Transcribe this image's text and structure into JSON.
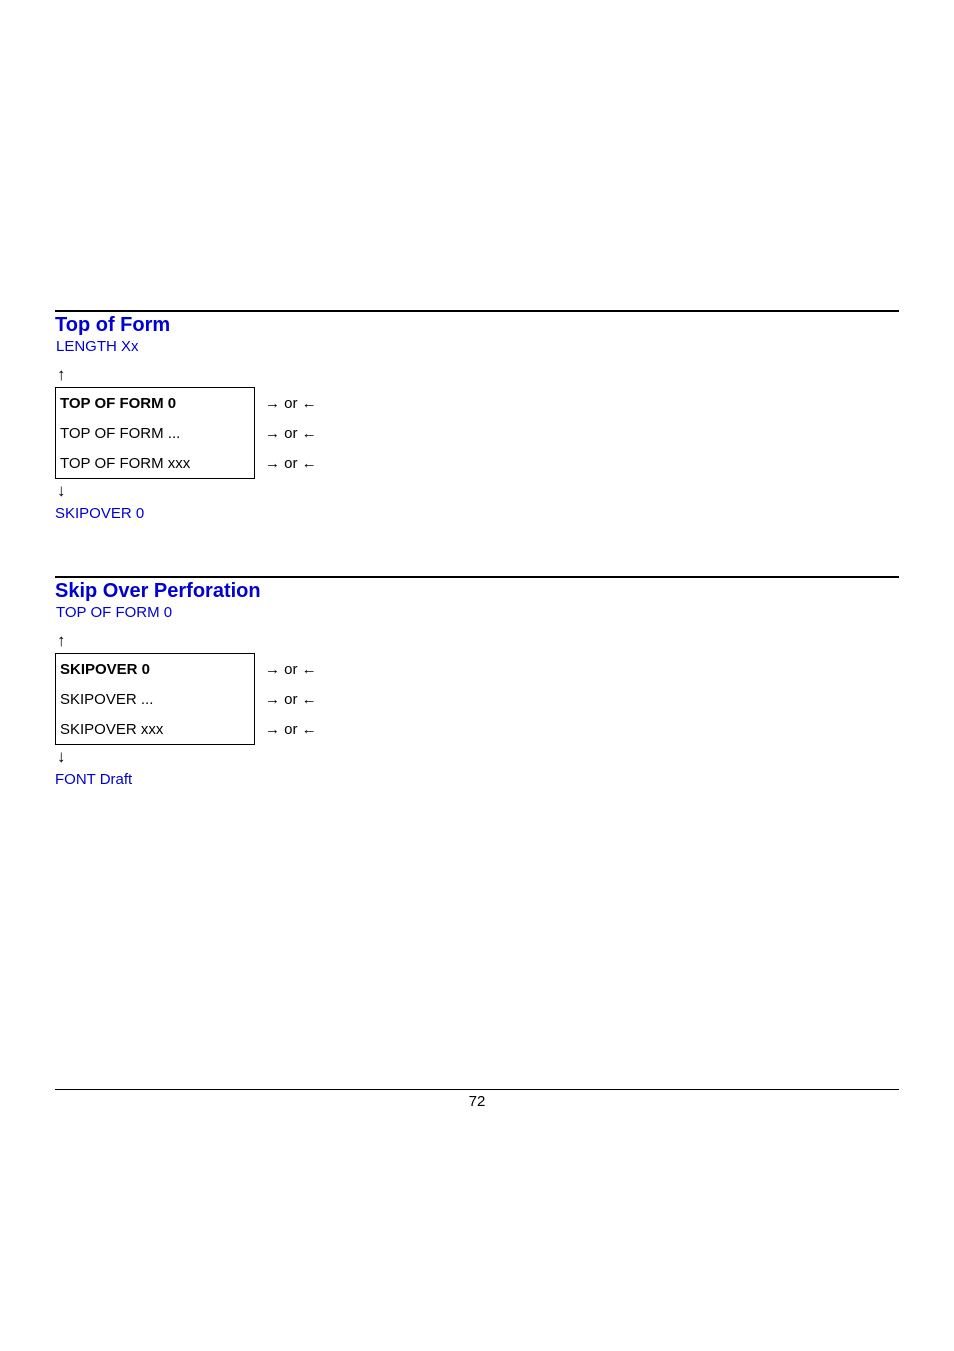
{
  "sections": [
    {
      "title": "Top of Form",
      "subhead": "LENGTH Xx",
      "up": "↑",
      "rows": [
        {
          "label": "TOP OF FORM 0",
          "right": "→ or ←",
          "bold": true
        },
        {
          "label": "TOP OF FORM ...",
          "right": "→ or ←",
          "bold": false
        },
        {
          "label": "TOP OF FORM xxx",
          "right": "→ or ←",
          "bold": false
        }
      ],
      "down": "↓",
      "next": "SKIPOVER 0"
    },
    {
      "title": "Skip Over Perforation",
      "subhead": "TOP OF FORM 0",
      "up": "↑",
      "rows": [
        {
          "label": "SKIPOVER  0",
          "right": "→ or ←",
          "bold": true
        },
        {
          "label": "SKIPOVER ...",
          "right": "→ or ←",
          "bold": false
        },
        {
          "label": "SKIPOVER xxx",
          "right": "→ or ←",
          "bold": false
        }
      ],
      "down": "↓",
      "next": "FONT Draft"
    }
  ],
  "page_number": "72"
}
